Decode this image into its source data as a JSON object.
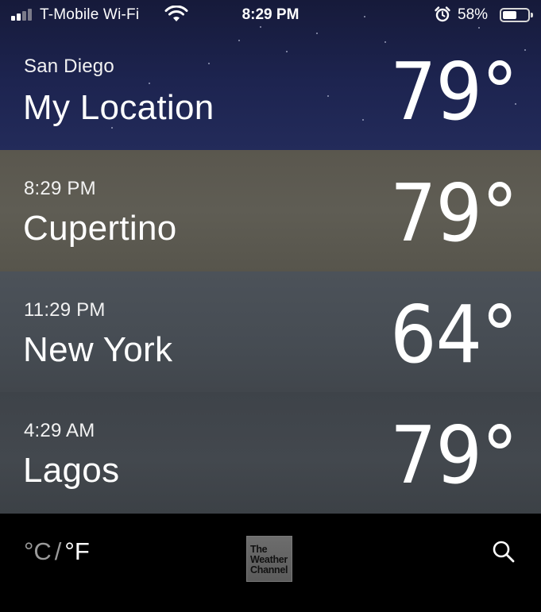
{
  "status_bar": {
    "carrier": "T-Mobile Wi-Fi",
    "time": "8:29 PM",
    "battery_percent": "58%",
    "battery_level": 0.58,
    "signal_bars": 2,
    "icons": [
      "signal-icon",
      "wifi-icon",
      "alarm-icon",
      "battery-icon"
    ]
  },
  "cities": [
    {
      "subtitle": "San Diego",
      "name": "My Location",
      "temp": "79°"
    },
    {
      "subtitle": "8:29 PM",
      "name": "Cupertino",
      "temp": "79°"
    },
    {
      "subtitle": "11:29 PM",
      "name": "New York",
      "temp": "64°"
    },
    {
      "subtitle": "4:29 AM",
      "name": "Lagos",
      "temp": "79°"
    }
  ],
  "toolbar": {
    "celsius": "°C",
    "separator": "/",
    "fahrenheit": "°F",
    "logo_lines": [
      "The",
      "Weather",
      "Channel"
    ],
    "search_icon": "search-icon"
  }
}
